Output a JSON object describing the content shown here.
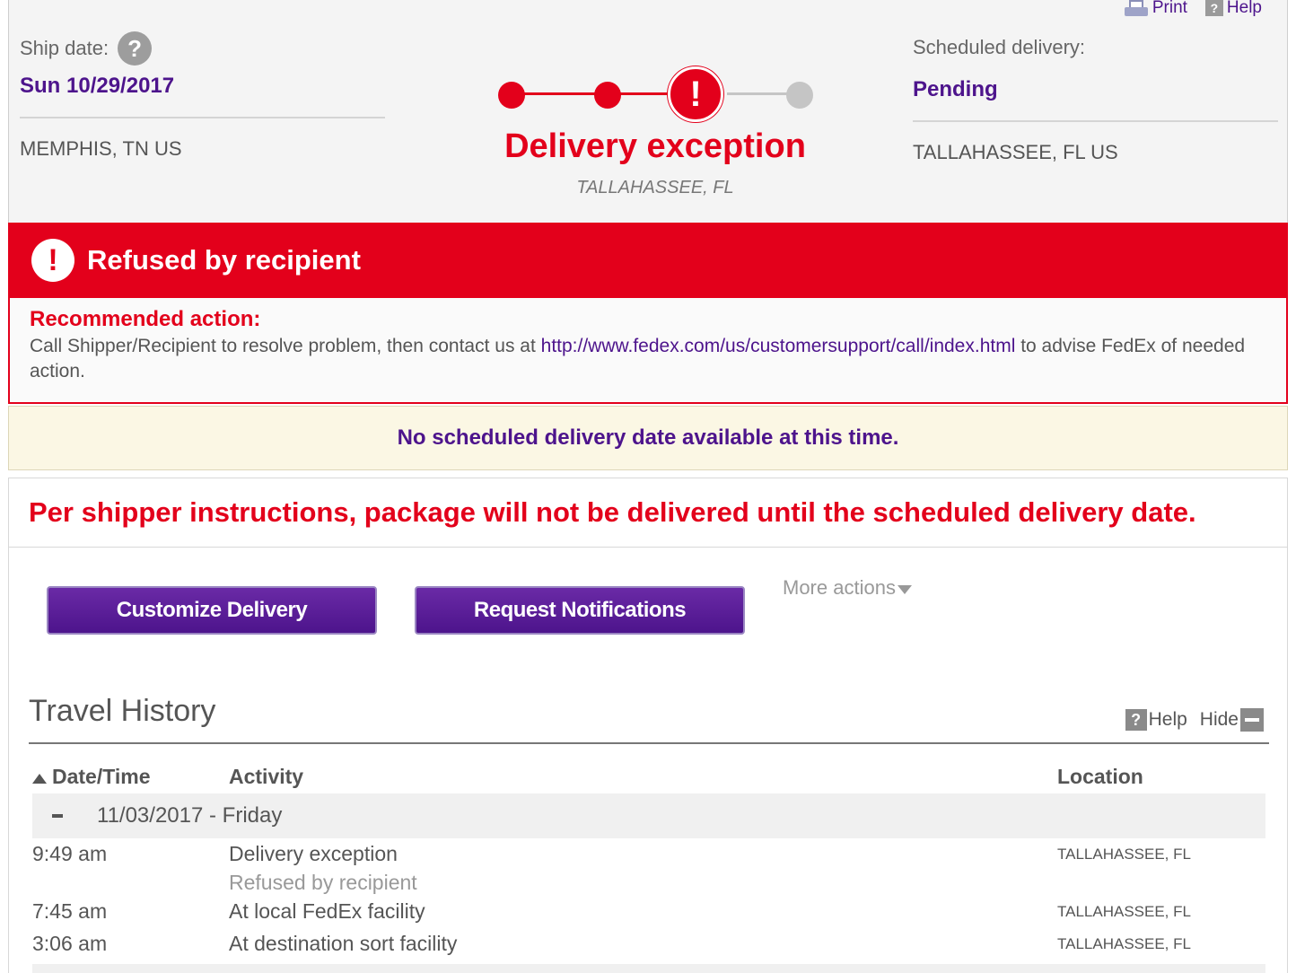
{
  "header_links": {
    "print": "Print",
    "help": "Help"
  },
  "ship": {
    "label": "Ship date:",
    "help_glyph": "?",
    "date": "Sun 10/29/2017",
    "location": "MEMPHIS, TN US"
  },
  "scheduled": {
    "label": "Scheduled delivery:",
    "value": "Pending",
    "location": "TALLAHASSEE, FL US"
  },
  "progress": {
    "steps_completed": 2,
    "current_step": 3,
    "total_steps": 4,
    "status_glyph": "!",
    "status": "Delivery exception",
    "status_location": "TALLAHASSEE, FL",
    "accent_color": "#e3001b",
    "pending_color": "#c5c5c5"
  },
  "alert": {
    "icon": "exclamation-icon",
    "glyph": "!",
    "title": "Refused by recipient",
    "action_label": "Recommended action:",
    "action_text_pre": "Call Shipper/Recipient to resolve problem, then contact us at ",
    "action_link": "http://www.fedex.com/us/customersupport/call/index.html",
    "action_text_post": " to advise FedEx of needed action."
  },
  "notice": "No scheduled delivery date available at this time.",
  "instructions": "Per shipper instructions, package will not be delivered until the scheduled delivery date.",
  "actions": {
    "customize": "Customize Delivery",
    "notifications": "Request Notifications",
    "more": "More actions"
  },
  "travel_history": {
    "title": "Travel History",
    "help_glyph": "?",
    "help": "Help",
    "hide": "Hide",
    "columns": {
      "datetime": "Date/Time",
      "activity": "Activity",
      "location": "Location"
    },
    "day": "11/03/2017 - Friday",
    "events": [
      {
        "time": "9:49 am",
        "activity": "Delivery exception",
        "detail": "Refused by recipient",
        "location": "TALLAHASSEE, FL"
      },
      {
        "time": "7:45 am",
        "activity": "At local FedEx facility",
        "detail": "",
        "location": "TALLAHASSEE, FL"
      },
      {
        "time": "3:06 am",
        "activity": "At destination sort facility",
        "detail": "",
        "location": "TALLAHASSEE, FL"
      }
    ]
  },
  "colors": {
    "brand_purple": "#4d148c",
    "alert_red": "#e3001b",
    "notice_bg": "#fbf7e4"
  }
}
